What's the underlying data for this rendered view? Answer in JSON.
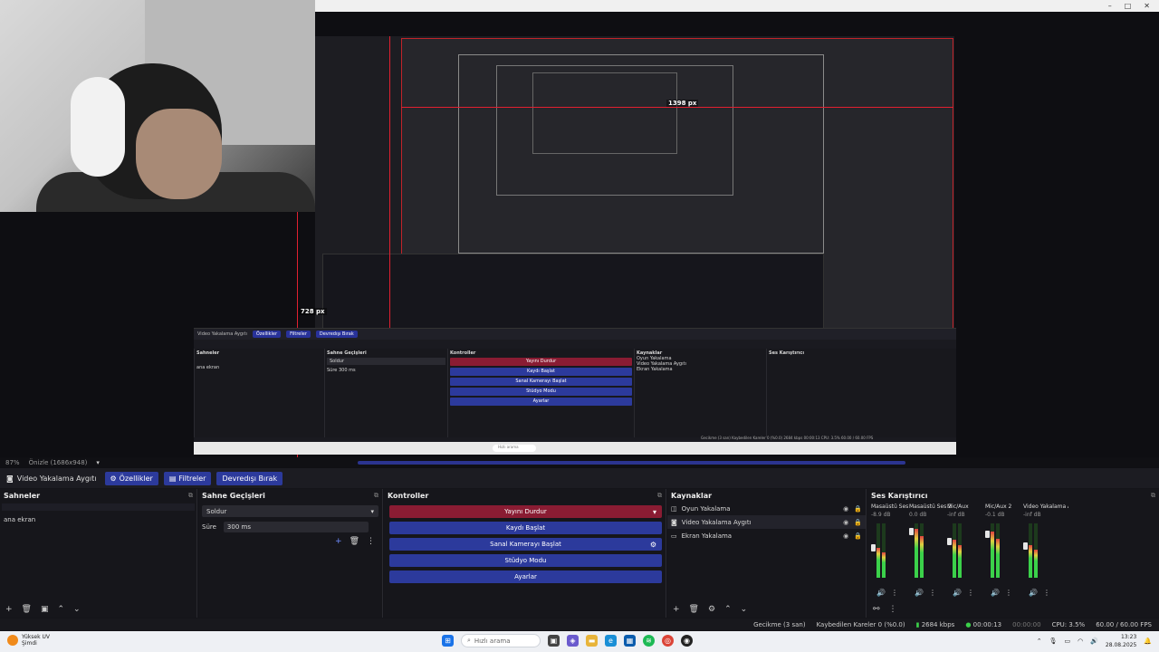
{
  "window": {
    "controls": [
      "–",
      "□",
      "✕"
    ]
  },
  "preview": {
    "label_width": "1398 px",
    "label_height": "728 px",
    "nested_width": "1398 px"
  },
  "mini": {
    "source": "Video Yakalama Aygıtı",
    "props": "Özellikler",
    "filters": "Filtreler",
    "deactivate": "Devredışı Bırak",
    "scenes_title": "Sahneler",
    "scene": "ana ekran",
    "transitions_title": "Sahne Geçişleri",
    "fade": "Soldur",
    "dur_label": "Süre",
    "dur": "300 ms",
    "controls_title": "Kontroller",
    "ctrl": [
      "Yayını Durdur",
      "Kaydı Başlat",
      "Sanal Kamerayı Başlat",
      "Stüdyo Modu",
      "Ayarlar"
    ],
    "sources_title": "Kaynaklar",
    "sources": [
      "Oyun Yakalama",
      "Video Yakalama Aygıtı",
      "Ekran Yakalama"
    ],
    "mixer_title": "Ses Karıştırıcı",
    "status": "Gecikme (3 san)  Kaybedilen Kareler 0 (%0.0)  2684 kbps  00:00:13  CPU: 3.5%  60.00 / 60.00 FPS",
    "zoom": "87%",
    "canvas": "Önizle (1686x948)",
    "search": "Hızlı arama"
  },
  "zoom_bar": {
    "zoom": "87%",
    "canvas_size": "Önizle (1686x948)"
  },
  "toolbar": {
    "source_name": "Video Yakalama Aygıtı",
    "properties": "Özellikler",
    "filters": "Filtreler",
    "deactivate": "Devredışı Bırak"
  },
  "scenes": {
    "title": "Sahneler",
    "items": [
      "ana ekran"
    ]
  },
  "transitions": {
    "title": "Sahne Geçişleri",
    "selected": "Soldur",
    "duration_label": "Süre",
    "duration_value": "300 ms"
  },
  "controls": {
    "title": "Kontroller",
    "stop_stream": "Yayını Durdur",
    "start_record": "Kaydı Başlat",
    "virtual_cam": "Sanal Kamerayı Başlat",
    "studio_mode": "Stüdyo Modu",
    "settings": "Ayarlar"
  },
  "sources": {
    "title": "Kaynaklar",
    "items": [
      "Oyun Yakalama",
      "Video Yakalama Aygıtı",
      "Ekran Yakalama"
    ]
  },
  "mixer": {
    "title": "Ses Karıştırıcı",
    "channels": [
      {
        "name": "Masaüstü Ses",
        "db": "-8.9 dB",
        "level": 0.55
      },
      {
        "name": "Masaüstü Ses 2",
        "db": "0.0 dB",
        "level": 0.9
      },
      {
        "name": "Mic/Aux",
        "db": "-inf dB",
        "level": 0.7
      },
      {
        "name": "Mic/Aux 2",
        "db": "-0.1 dB",
        "level": 0.85
      },
      {
        "name": "Video Yakalama Ay",
        "db": "-inf dB",
        "level": 0.6
      }
    ]
  },
  "statusbar": {
    "delay": "Gecikme (3 san)",
    "dropped": "Kaybedilen Kareler 0 (%0.0)",
    "bitrate": "2684 kbps",
    "stream_time": "00:00:13",
    "rec_time": "00:00:00",
    "cpu": "CPU: 3.5%",
    "fps": "60.00 / 60.00 FPS"
  },
  "taskbar": {
    "weather_label": "Yüksek UV",
    "weather_sub": "Şimdi",
    "search_placeholder": "Hızlı arama",
    "time": "13:23",
    "date": "28.08.2025"
  },
  "colors": {
    "accent": "#2c3a9c",
    "stop": "#8a1c33",
    "red_guide": "#e02030"
  }
}
